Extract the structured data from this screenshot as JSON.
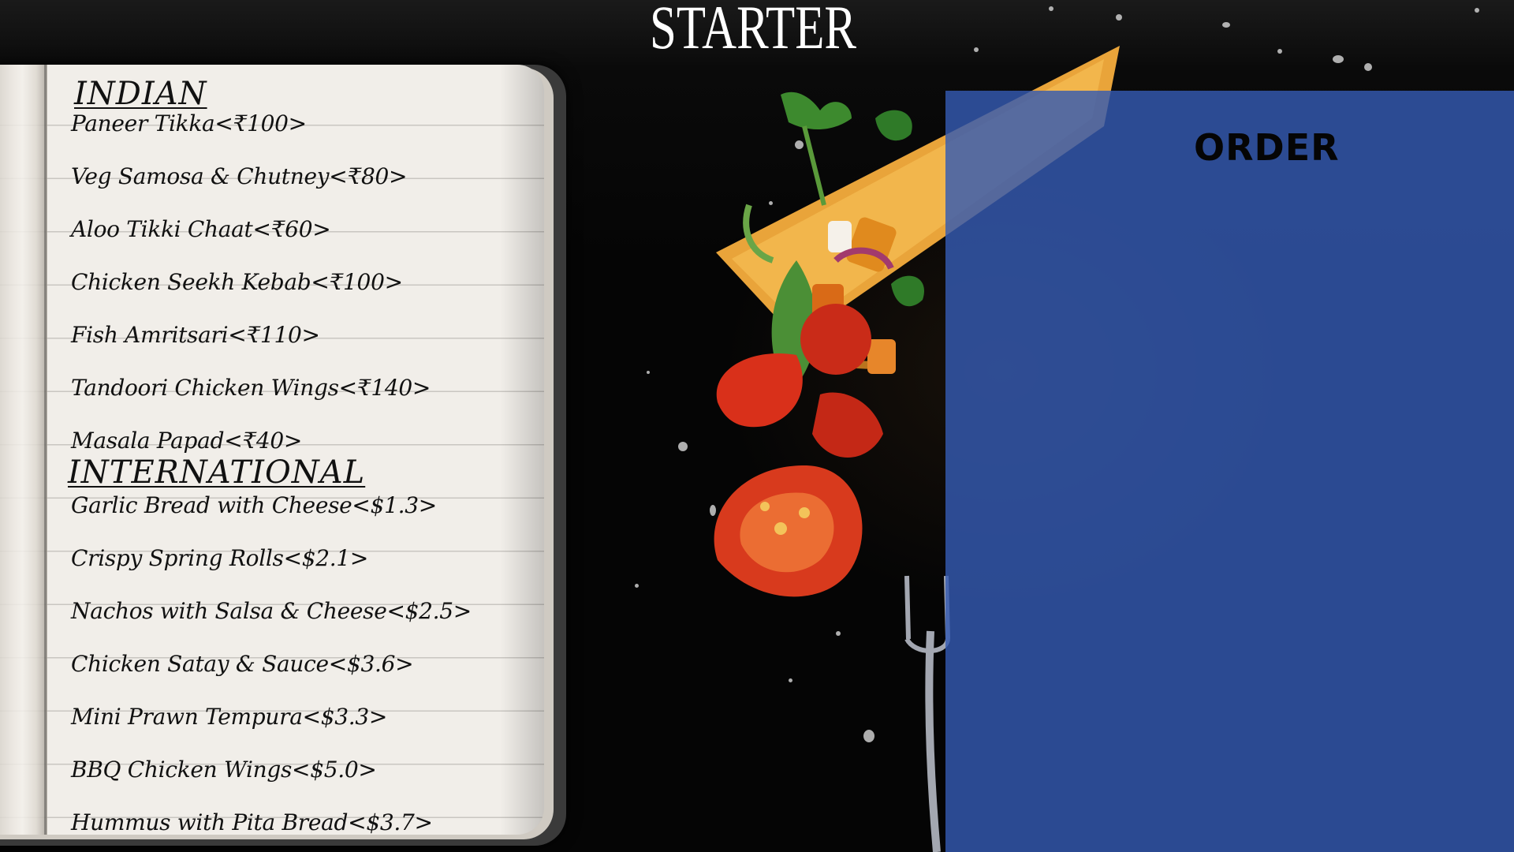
{
  "header": {
    "title": "STARTER"
  },
  "menu": {
    "indian": {
      "heading": "INDIAN",
      "items": [
        "Paneer Tikka<₹100>",
        "Veg Samosa & Chutney<₹80>",
        "Aloo Tikki Chaat<₹60>",
        "Chicken Seekh Kebab<₹100>",
        "Fish Amritsari<₹110>",
        "Tandoori Chicken Wings<₹140>",
        "Masala Papad<₹40>"
      ]
    },
    "international": {
      "heading": "INTERNATIONAL",
      "items": [
        "Garlic Bread with Cheese<$1.3>",
        "Crispy Spring Rolls<$2.1>",
        "Nachos with Salsa & Cheese<$2.5>",
        "Chicken Satay & Sauce<$3.6>",
        "Mini Prawn Tempura<$3.3>",
        "BBQ Chicken Wings<$5.0>",
        "Hummus with Pita Bread<$3.7>"
      ]
    }
  },
  "order": {
    "title": "ORDER"
  },
  "colors": {
    "panel": "#345ab2",
    "background": "#050505",
    "paper": "#f1eee9"
  }
}
